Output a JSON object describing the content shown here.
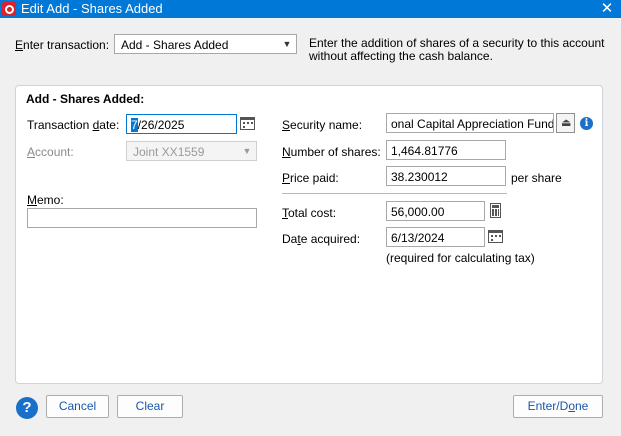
{
  "window": {
    "title": "Edit Add - Shares Added",
    "close_glyph": "✕"
  },
  "transaction": {
    "label_pre": "E",
    "label_rest": "nter transaction:",
    "selected": "Add - Shares Added",
    "description": "Enter the addition of shares of a security to this account without affecting the cash balance."
  },
  "panel": {
    "title": "Add - Shares Added:",
    "date_label": {
      "pre": "Transaction ",
      "key": "d",
      "post": "ate:"
    },
    "date_value_sel": "7",
    "date_value_rest": "/26/2025",
    "account_label": {
      "key": "A",
      "post": "ccount:"
    },
    "account_value": "Joint XX1559",
    "memo_label": {
      "key": "M",
      "post": "emo:"
    },
    "memo_value": "",
    "security_label": {
      "key": "S",
      "post": "ecurity name:"
    },
    "security_value": "onal Capital Appreciation Fund",
    "shares_label": {
      "key": "N",
      "post": "umber of shares:"
    },
    "shares_value": "1,464.81776",
    "price_label": {
      "key": "P",
      "post": "rice paid:"
    },
    "price_value": "38.230012",
    "price_suffix": "per share",
    "total_label": {
      "key": "T",
      "post": "otal cost:"
    },
    "total_value": "56,000.00",
    "acquired_label": {
      "pre": "Da",
      "key": "t",
      "post": "e acquired:"
    },
    "acquired_value": "6/13/2024",
    "acquired_note": "(required for calculating tax)"
  },
  "buttons": {
    "help": "?",
    "cancel": "Cancel",
    "clear": "Clear",
    "enter_pre": "Enter/D",
    "enter_key": "o",
    "enter_post": "ne"
  }
}
